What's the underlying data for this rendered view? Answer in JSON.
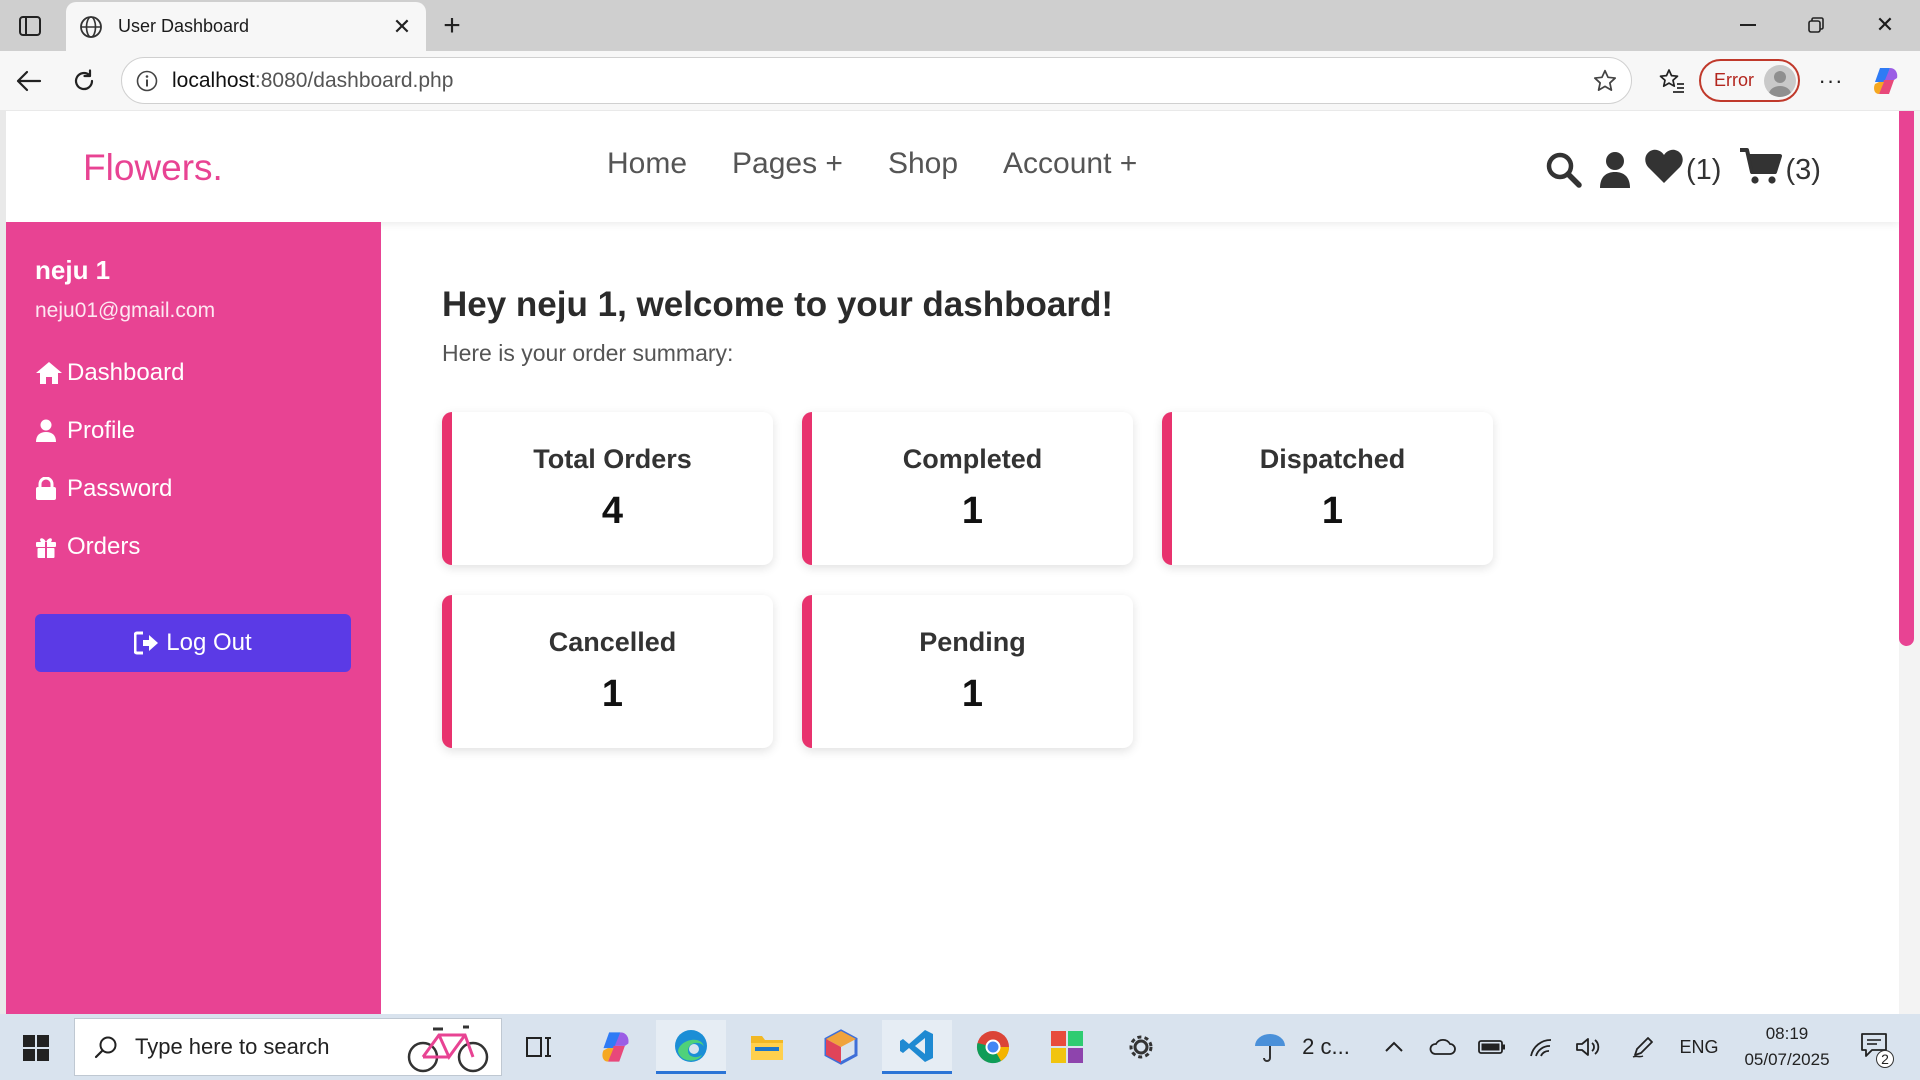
{
  "browser": {
    "tab_title": "User Dashboard",
    "url_host": "localhost",
    "url_path": ":8080/dashboard.php",
    "profile_status": "Error",
    "more_label": "···"
  },
  "site": {
    "logo": "Flowers.",
    "nav": [
      {
        "label": "Home"
      },
      {
        "label": "Pages +"
      },
      {
        "label": "Shop"
      },
      {
        "label": "Account +"
      }
    ],
    "wishlist_count": "(1)",
    "cart_count": "(3)"
  },
  "sidebar": {
    "user_name": "neju 1",
    "user_email": "neju01@gmail.com",
    "items": [
      {
        "label": "Dashboard",
        "icon": "home-icon"
      },
      {
        "label": "Profile",
        "icon": "user-icon"
      },
      {
        "label": "Password",
        "icon": "lock-icon"
      },
      {
        "label": "Orders",
        "icon": "gift-icon"
      }
    ],
    "logout_label": "Log Out"
  },
  "main": {
    "welcome": "Hey neju 1, welcome to your dashboard!",
    "subtitle": "Here is your order summary:",
    "cards": [
      {
        "label": "Total Orders",
        "value": "4"
      },
      {
        "label": "Completed",
        "value": "1"
      },
      {
        "label": "Dispatched",
        "value": "1"
      },
      {
        "label": "Cancelled",
        "value": "1"
      },
      {
        "label": "Pending",
        "value": "1"
      }
    ]
  },
  "taskbar": {
    "search_placeholder": "Type here to search",
    "weather": "2 c...",
    "language": "ENG",
    "time": "08:19",
    "date": "05/07/2025",
    "notification_count": "2"
  },
  "colors": {
    "accent_pink": "#e84393",
    "card_border": "#e8336e",
    "logout_button": "#5b3ae6"
  }
}
